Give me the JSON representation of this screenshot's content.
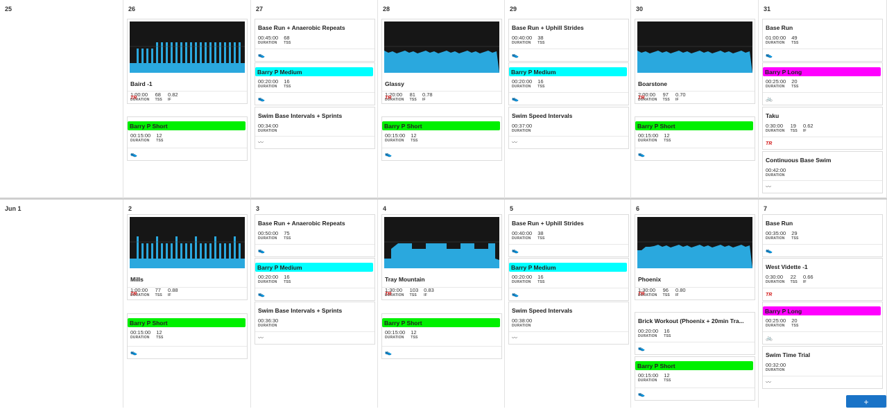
{
  "colors": {
    "chart_bg": "#161616",
    "chart_fill": "#2aa8de",
    "highlight_cyan": "#00ffff",
    "highlight_green": "#00f000",
    "highlight_magenta": "#ff00ff",
    "tr_red": "#d42020",
    "add_button": "#1a73c7"
  },
  "labels": {
    "duration": "DURATION",
    "tss": "TSS",
    "if": "IF"
  },
  "icons": {
    "shoe": "run-shoe-icon",
    "bike": "bike-icon",
    "swim": "swim-wave-icon"
  },
  "add_button": "+",
  "weeks": [
    {
      "days": [
        {
          "num": "25",
          "items": []
        },
        {
          "num": "26",
          "items": [
            {
              "kind": "tr",
              "title": "Baird -1",
              "duration": "1:00:00",
              "tss": "68",
              "if": "0.82",
              "tr": "TR"
            },
            {
              "kind": "hl",
              "color": "green",
              "title": "Barry P Short",
              "duration": "00:15:00",
              "tss": "12",
              "icon": "shoe"
            }
          ]
        },
        {
          "num": "27",
          "items": [
            {
              "kind": "plain",
              "title": "Base Run + Anaerobic Repeats",
              "duration": "00:45:00",
              "tss": "68",
              "icon": "shoe"
            },
            {
              "kind": "hl",
              "color": "cyan",
              "title": "Barry P Medium",
              "duration": "00:20:00",
              "tss": "16",
              "icon": "shoe"
            },
            {
              "kind": "plain",
              "title": "Swim Base Intervals + Sprints",
              "duration": "00:34:00",
              "icon": "swim"
            }
          ]
        },
        {
          "num": "28",
          "items": [
            {
              "kind": "tr",
              "title": "Glassy",
              "duration": "1:20:00",
              "tss": "81",
              "if": "0.78",
              "tr": "TR"
            },
            {
              "kind": "hl",
              "color": "green",
              "title": "Barry P Short",
              "duration": "00:15:00",
              "tss": "12",
              "icon": "shoe"
            }
          ]
        },
        {
          "num": "29",
          "items": [
            {
              "kind": "plain",
              "title": "Base Run + Uphill Strides",
              "duration": "00:40:00",
              "tss": "38",
              "icon": "shoe"
            },
            {
              "kind": "hl",
              "color": "cyan",
              "title": "Barry P Medium",
              "duration": "00:20:00",
              "tss": "16",
              "icon": "shoe"
            },
            {
              "kind": "plain",
              "title": "Swim Speed Intervals",
              "duration": "00:37:00",
              "icon": "swim"
            }
          ]
        },
        {
          "num": "30",
          "items": [
            {
              "kind": "tr",
              "title": "Boarstone",
              "duration": "2:00:00",
              "tss": "97",
              "if": "0.70",
              "tr": "TR"
            },
            {
              "kind": "hl",
              "color": "green",
              "title": "Barry P Short",
              "duration": "00:15:00",
              "tss": "12",
              "icon": "shoe"
            }
          ]
        },
        {
          "num": "31",
          "items": [
            {
              "kind": "plain",
              "title": "Base Run",
              "duration": "01:00:00",
              "tss": "49",
              "icon": "shoe"
            },
            {
              "kind": "hl",
              "color": "magenta",
              "title": "Barry P Long",
              "duration": "00:25:00",
              "tss": "20",
              "icon": "bike"
            },
            {
              "kind": "trsmall",
              "title": "Taku",
              "duration": "0:30:00",
              "tss": "19",
              "if": "0.62",
              "tr": "TR"
            },
            {
              "kind": "plain",
              "title": "Continuous Base Swim",
              "duration": "00:42:00",
              "icon": "swim"
            }
          ]
        }
      ]
    },
    {
      "days": [
        {
          "num": "Jun 1",
          "items": []
        },
        {
          "num": "2",
          "items": [
            {
              "kind": "tr",
              "title": "Mills",
              "duration": "1:00:00",
              "tss": "77",
              "if": "0.88",
              "tr": "TR"
            },
            {
              "kind": "hl",
              "color": "green",
              "title": "Barry P Short",
              "duration": "00:15:00",
              "tss": "12",
              "icon": "shoe"
            }
          ]
        },
        {
          "num": "3",
          "items": [
            {
              "kind": "plain",
              "title": "Base Run + Anaerobic Repeats",
              "duration": "00:50:00",
              "tss": "75",
              "icon": "shoe"
            },
            {
              "kind": "hl",
              "color": "cyan",
              "title": "Barry P Medium",
              "duration": "00:20:00",
              "tss": "16",
              "icon": "shoe"
            },
            {
              "kind": "plain",
              "title": "Swim Base Intervals + Sprints",
              "duration": "00:36:30",
              "icon": "swim"
            }
          ]
        },
        {
          "num": "4",
          "items": [
            {
              "kind": "tr",
              "title": "Tray Mountain",
              "duration": "1:30:00",
              "tss": "103",
              "if": "0.83",
              "tr": "TR"
            },
            {
              "kind": "hl",
              "color": "green",
              "title": "Barry P Short",
              "duration": "00:15:00",
              "tss": "12",
              "icon": "shoe"
            }
          ]
        },
        {
          "num": "5",
          "items": [
            {
              "kind": "plain",
              "title": "Base Run + Uphill Strides",
              "duration": "00:40:00",
              "tss": "38",
              "icon": "shoe"
            },
            {
              "kind": "hl",
              "color": "cyan",
              "title": "Barry P Medium",
              "duration": "00:20:00",
              "tss": "16",
              "icon": "shoe"
            },
            {
              "kind": "plain",
              "title": "Swim Speed Intervals",
              "duration": "00:38:00",
              "icon": "swim"
            }
          ]
        },
        {
          "num": "6",
          "items": [
            {
              "kind": "tr",
              "title": "Phoenix",
              "duration": "1:30:00",
              "tss": "96",
              "if": "0.80",
              "tr": "TR"
            },
            {
              "kind": "plain",
              "title": "Brick Workout (Phoenix + 20min Tra...",
              "duration": "00:20:00",
              "tss": "16",
              "icon": "shoe"
            },
            {
              "kind": "hl",
              "color": "green",
              "title": "Barry P Short",
              "duration": "00:15:00",
              "tss": "12",
              "icon": "shoe"
            }
          ]
        },
        {
          "num": "7",
          "items": [
            {
              "kind": "plain",
              "title": "Base Run",
              "duration": "00:35:00",
              "tss": "29",
              "icon": "shoe"
            },
            {
              "kind": "trsmall",
              "title": "West Vidette -1",
              "duration": "0:30:00",
              "tss": "22",
              "if": "0.66",
              "tr": "TR"
            },
            {
              "kind": "hl",
              "color": "magenta",
              "title": "Barry P Long",
              "duration": "00:25:00",
              "tss": "20",
              "icon": "bike"
            },
            {
              "kind": "plain",
              "title": "Swim Time Trial",
              "duration": "00:32:00",
              "icon": "swim"
            }
          ]
        }
      ]
    }
  ]
}
